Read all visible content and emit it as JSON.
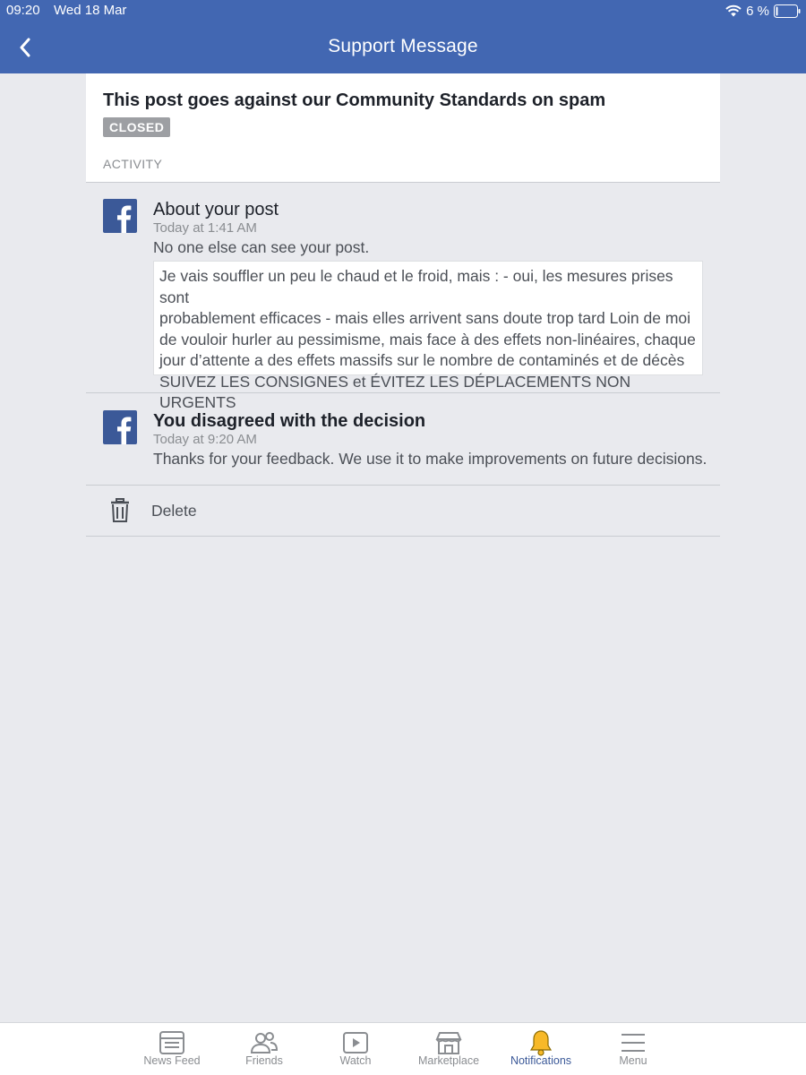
{
  "status_bar": {
    "time": "09:20",
    "date": "Wed 18 Mar",
    "battery": "6 %"
  },
  "nav": {
    "title": "Support Message",
    "back_icon": "chevron-left-icon"
  },
  "card": {
    "title": "This post goes against our Community Standards on spam",
    "status_badge": "CLOSED",
    "section_label": "ACTIVITY"
  },
  "activity": [
    {
      "title": "About your post",
      "time": "Today at 1:41 AM",
      "description": "No one else can see your post.",
      "post_lines": [
        "Je vais souffler un peu le chaud et le froid, mais : - oui, les mesures prises sont",
        "probablement efficaces - mais elles arrivent sans doute trop tard Loin de moi",
        "de vouloir hurler au pessimisme, mais face à des effets non-linéaires, chaque",
        "jour d’attente a des effets massifs sur le nombre de contaminés et de décès",
        "SUIVEZ LES CONSIGNES et ÉVITEZ LES DÉPLACEMENTS NON URGENTS"
      ]
    },
    {
      "title": "You disagreed with the decision",
      "time": "Today at 9:20 AM",
      "description": "Thanks for your feedback. We use it to make improvements on future decisions."
    }
  ],
  "delete": {
    "label": "Delete",
    "icon": "trash-icon"
  },
  "tabs": [
    {
      "label": "News Feed",
      "icon": "news-feed-icon",
      "active": false
    },
    {
      "label": "Friends",
      "icon": "friends-icon",
      "active": false
    },
    {
      "label": "Watch",
      "icon": "watch-icon",
      "active": false
    },
    {
      "label": "Marketplace",
      "icon": "marketplace-icon",
      "active": false
    },
    {
      "label": "Notifications",
      "icon": "bell-icon",
      "active": true
    },
    {
      "label": "Menu",
      "icon": "menu-icon",
      "active": false
    }
  ],
  "colors": {
    "brand_blue": "#4267b2",
    "background": "#e9eaee",
    "badge_gray": "#9d9fa3",
    "notification_bell": "#f7b928"
  }
}
